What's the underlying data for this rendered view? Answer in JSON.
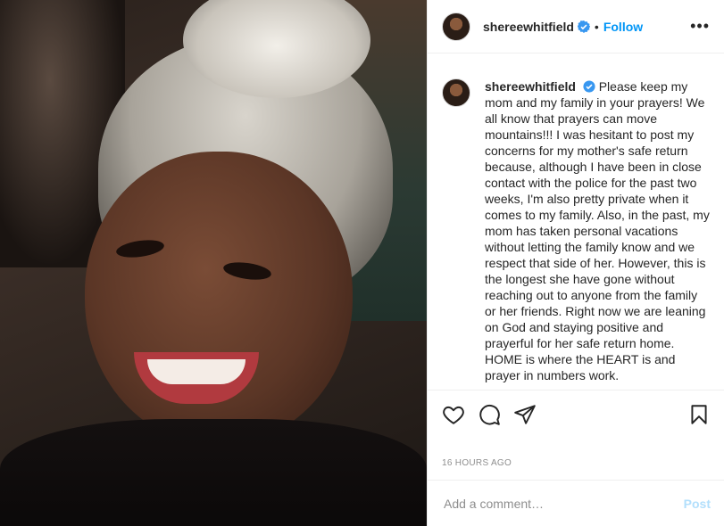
{
  "post": {
    "username": "shereewhitfield",
    "follow_label": "Follow",
    "separator": "•",
    "more_label": "•••",
    "caption": "Please keep my mom and my family in your prayers! We all know that prayers can move mountains!!! I was hesitant to post my concerns for my mother's safe return because, although I have been in close contact with the police for the past two weeks, I'm also pretty private when it comes to my family. Also, in the past, my mom has taken personal vacations without letting the family know and we respect that side of her. However, this is the longest she have gone without reaching out to anyone from the family or her friends. Right now we are leaning on God and staying positive and prayerful for her safe return home. HOME is where the HEART is and prayer in numbers work.",
    "timestamp": "16 HOURS AGO"
  },
  "comment": {
    "placeholder": "Add a comment…",
    "post_label": "Post"
  },
  "icons": {
    "verified": "verified-badge-icon",
    "like": "heart-icon",
    "comment": "comment-bubble-icon",
    "share": "paper-plane-icon",
    "save": "bookmark-icon",
    "more": "more-options-icon"
  },
  "colors": {
    "accent": "#0095f6",
    "post_disabled": "#b2dffc",
    "muted": "#8e8e8e"
  }
}
